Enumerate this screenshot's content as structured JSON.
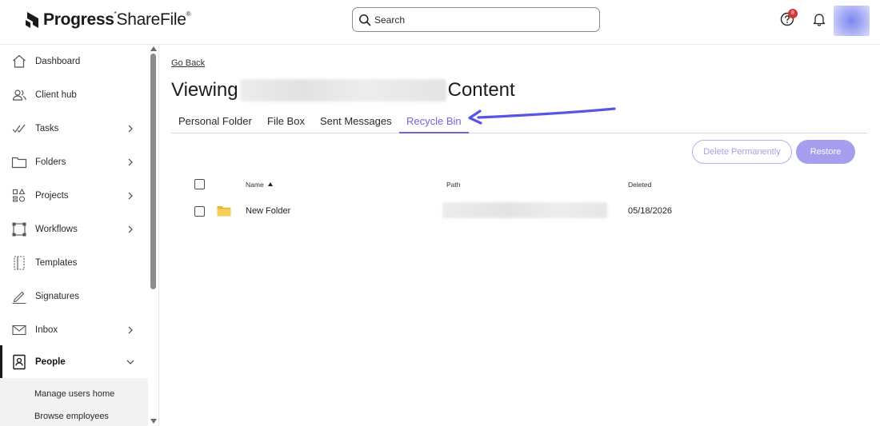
{
  "header": {
    "logo": {
      "brand_bold": "Progress",
      "brand_product": "ShareFile"
    },
    "search": {
      "placeholder": "Search"
    },
    "help": {
      "icon": "help-icon",
      "badge_count": "8",
      "badge_color": "#d43636"
    },
    "notifications": {
      "icon": "bell-icon"
    },
    "avatar": {
      "icon": "user-avatar"
    }
  },
  "sidebar": {
    "items": [
      {
        "label": "Dashboard",
        "icon": "home-icon",
        "chevron": false
      },
      {
        "label": "Client hub",
        "icon": "users-icon",
        "chevron": false
      },
      {
        "label": "Tasks",
        "icon": "tasks-check-icon",
        "chevron": true
      },
      {
        "label": "Folders",
        "icon": "folder-outline-icon",
        "chevron": true
      },
      {
        "label": "Projects",
        "icon": "projects-icon",
        "chevron": true
      },
      {
        "label": "Workflows",
        "icon": "workflow-icon",
        "chevron": true
      },
      {
        "label": "Templates",
        "icon": "template-icon",
        "chevron": false
      },
      {
        "label": "Signatures",
        "icon": "pen-icon",
        "chevron": false
      },
      {
        "label": "Inbox",
        "icon": "mail-icon",
        "chevron": true
      },
      {
        "label": "People",
        "icon": "contact-card-icon",
        "chevron": "down",
        "active": true
      }
    ],
    "subitems": [
      {
        "label": "Manage users home"
      },
      {
        "label": "Browse employees"
      }
    ]
  },
  "main": {
    "go_back": "Go Back",
    "title_prefix": "Viewing",
    "title_suffix": "Content",
    "tabs": [
      {
        "label": "Personal Folder",
        "active": false
      },
      {
        "label": "File Box",
        "active": false
      },
      {
        "label": "Sent Messages",
        "active": false
      },
      {
        "label": "Recycle Bin",
        "active": true
      }
    ],
    "accent_color": "#6f64e0",
    "buttons": {
      "delete_permanently": "Delete Permanently",
      "restore": "Restore"
    },
    "table": {
      "columns": [
        "Name",
        "Path",
        "Deleted"
      ],
      "sort_column": "Name",
      "sort_direction": "ascending",
      "rows": [
        {
          "name": "New Folder",
          "type_icon": "folder-icon",
          "deleted": "05/18/2026"
        }
      ]
    }
  }
}
